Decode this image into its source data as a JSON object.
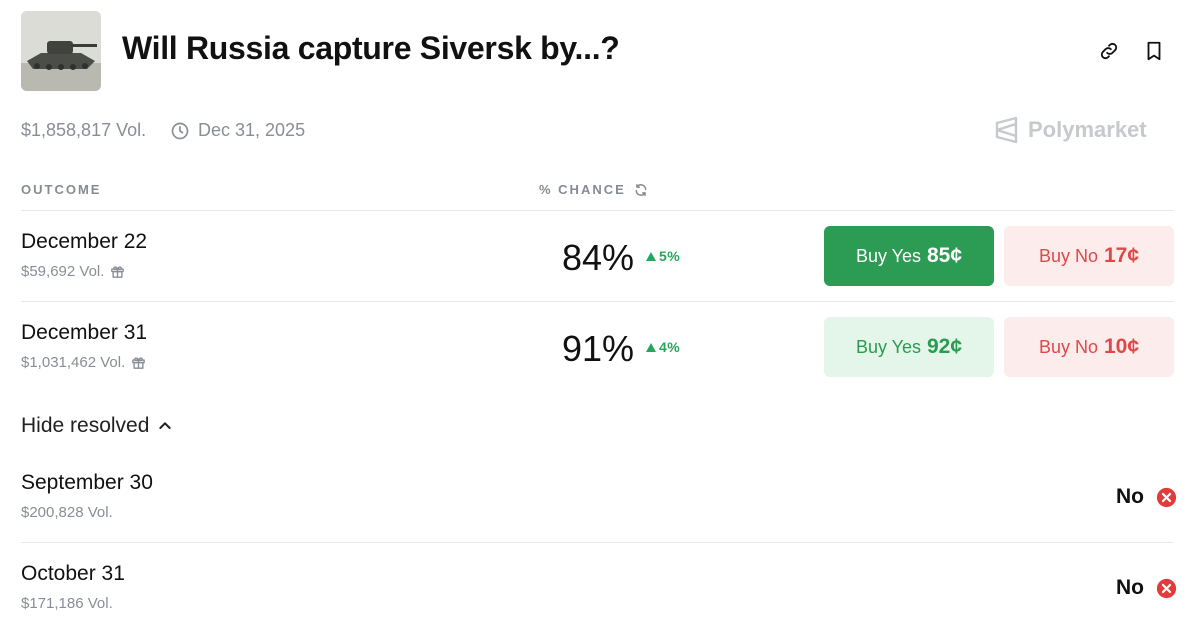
{
  "header": {
    "title": "Will Russia capture Siversk by...?",
    "volume": "$1,858,817 Vol.",
    "end_date": "Dec 31, 2025",
    "brand": "Polymarket",
    "icons": [
      "link-icon",
      "bookmark-icon",
      "clock-icon",
      "polymarket-logo"
    ]
  },
  "table": {
    "outcome_header": "OUTCOME",
    "chance_header": "% CHANCE"
  },
  "markets": [
    {
      "title": "December 22",
      "volume": "$59,692 Vol.",
      "chance": "84%",
      "delta": "5%",
      "yes_label": "Buy Yes",
      "yes_price": "85¢",
      "no_label": "Buy No",
      "no_price": "17¢"
    },
    {
      "title": "December 31",
      "volume": "$1,031,462 Vol.",
      "chance": "91%",
      "delta": "4%",
      "yes_label": "Buy Yes",
      "yes_price": "92¢",
      "no_label": "Buy No",
      "no_price": "10¢"
    }
  ],
  "toggle": {
    "label": "Hide resolved"
  },
  "resolved": [
    {
      "title": "September 30",
      "volume": "$200,828 Vol.",
      "result": "No"
    },
    {
      "title": "October 31",
      "volume": "$171,186 Vol.",
      "result": "No"
    }
  ],
  "colors": {
    "yes_active_bg": "#2c9b53",
    "yes_bg": "#e3f6e9",
    "no_bg": "#fcecec",
    "no_text": "#e04848",
    "up_green": "#27a55b",
    "resolved_red": "#e23b3b"
  }
}
